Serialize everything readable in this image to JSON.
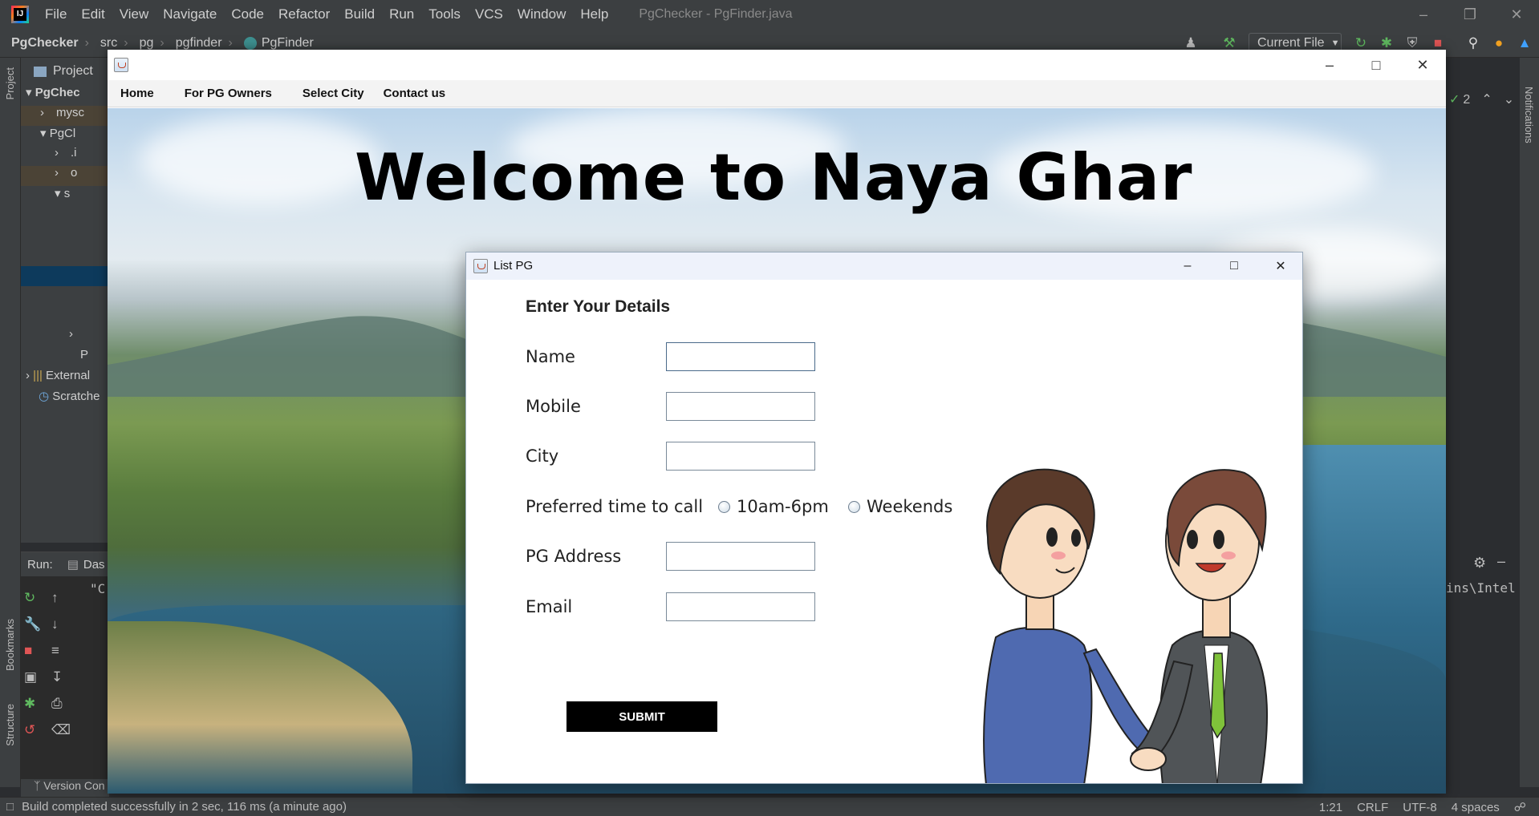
{
  "ide": {
    "menu": [
      "File",
      "Edit",
      "View",
      "Navigate",
      "Code",
      "Refactor",
      "Build",
      "Run",
      "Tools",
      "VCS",
      "Window",
      "Help"
    ],
    "window_title": "PgChecker - PgFinder.java",
    "breadcrumbs": [
      "PgChecker",
      "src",
      "pg",
      "pgfinder",
      "PgFinder"
    ],
    "run_config": "Current File",
    "project_tool_label": "Project",
    "left_stripe_project": "Project",
    "left_stripe_bookmarks": "Bookmarks",
    "left_stripe_structure": "Structure",
    "right_stripe_notifications": "Notifications",
    "problems_count": "2",
    "tree": {
      "root": "PgChec",
      "item1": "mysc",
      "item2": "PgCl",
      "item3": ".i",
      "item4": "o",
      "item5": "s",
      "item6": "P",
      "external": "External",
      "scratches": "Scratche"
    },
    "run_tab_label": "Run:",
    "run_tab_name": "Das",
    "run_console_line": "\"C",
    "editor_console_peek": "ins\\Intel",
    "version_control": "Version Con",
    "status": {
      "message": "Build completed successfully in 2 sec, 116 ms (a minute ago)",
      "position": "1:21",
      "line_sep": "CRLF",
      "encoding": "UTF-8",
      "indent": "4 spaces"
    }
  },
  "app": {
    "menu": [
      "Home",
      "For PG Owners",
      "Select City",
      "Contact us"
    ],
    "hero_title": "Welcome to Naya Ghar"
  },
  "dialog": {
    "title": "List PG",
    "heading": "Enter Your Details",
    "fields": {
      "name_label": "Name",
      "mobile_label": "Mobile",
      "city_label": "City",
      "time_label": "Preferred time to call",
      "address_label": "PG Address",
      "email_label": "Email"
    },
    "radio_options": [
      "10am-6pm",
      "Weekends"
    ],
    "submit_label": "SUBMIT"
  }
}
